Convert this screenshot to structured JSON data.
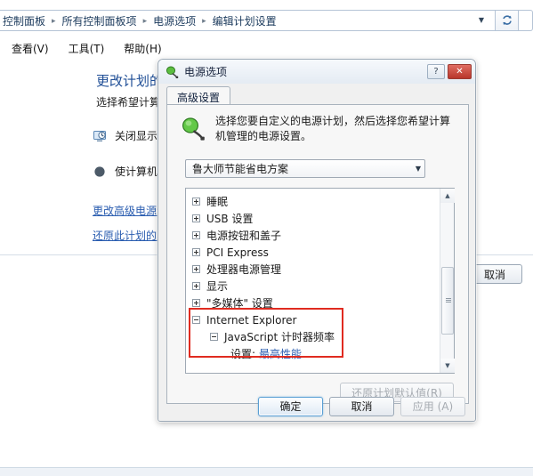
{
  "explorer": {
    "breadcrumb": {
      "items": [
        "控制面板",
        "所有控制面板项",
        "电源选项",
        "编辑计划设置"
      ],
      "separator": "▸",
      "chevron": "▼",
      "refresh_icon": "refresh-icon"
    },
    "menu": {
      "items": [
        "查看(V)",
        "工具(T)",
        "帮助(H)"
      ]
    },
    "page": {
      "heading": "更改计划的设置",
      "subtext": "选择希望计算机",
      "rows": [
        {
          "icon": "display-off-icon",
          "label": "关闭显示器"
        },
        {
          "icon": "sleep-moon-icon",
          "label": "使计算机进"
        }
      ],
      "links": [
        "更改高级电源设",
        "还原此计划的默"
      ],
      "cancel_label": "取消"
    }
  },
  "dialog": {
    "title": "电源选项",
    "title_icon": "power-plug-icon",
    "help_label": "?",
    "close_label": "✕",
    "tab_label": "高级设置",
    "description": "选择您要自定义的电源计划，然后选择您希望计算机管理的电源设置。",
    "description_icon": "power-plan-icon",
    "plan_combo": {
      "value": "鲁大师节能省电方案",
      "arrow": "▼"
    },
    "tree": [
      {
        "level": 0,
        "expander": "plus",
        "label": "睡眠"
      },
      {
        "level": 0,
        "expander": "plus",
        "label": "USB 设置"
      },
      {
        "level": 0,
        "expander": "plus",
        "label": "电源按钮和盖子"
      },
      {
        "level": 0,
        "expander": "plus",
        "label": "PCI Express"
      },
      {
        "level": 0,
        "expander": "plus",
        "label": "处理器电源管理"
      },
      {
        "level": 0,
        "expander": "plus",
        "label": "显示"
      },
      {
        "level": 0,
        "expander": "plus",
        "label": "\"多媒体\" 设置"
      },
      {
        "level": 0,
        "expander": "minus",
        "label": "Internet Explorer"
      },
      {
        "level": 1,
        "expander": "minus",
        "label": "JavaScript 计时器频率"
      },
      {
        "level": 2,
        "expander": "none",
        "label": "设置:",
        "value": "最高性能"
      }
    ],
    "highlight_color": "#e02b20",
    "value_color": "#2a5db0",
    "scrollbar": {
      "up": "▲",
      "down": "▼"
    },
    "restore_defaults_label": "还原计划默认值(R)",
    "buttons": {
      "ok": "确定",
      "cancel": "取消",
      "apply": "应用 (A)"
    }
  }
}
